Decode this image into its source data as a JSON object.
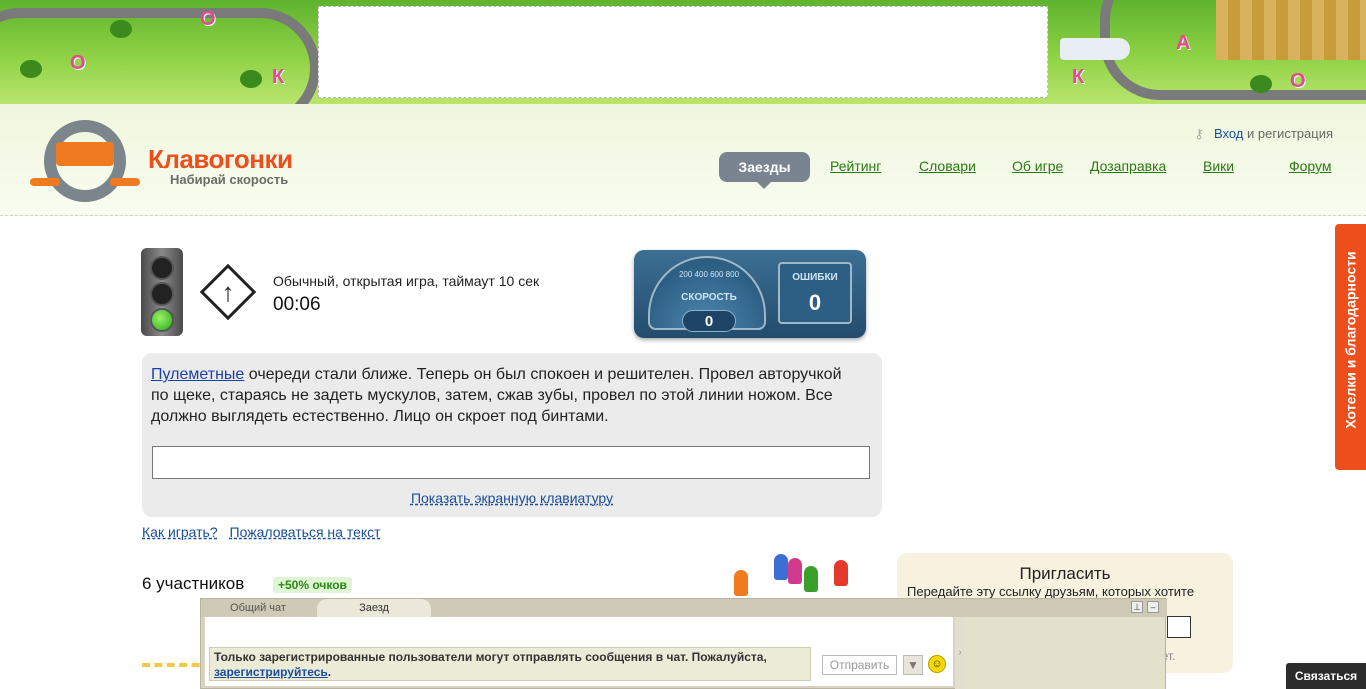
{
  "brand": {
    "name": "Клавогонки",
    "tagline": "Набирай скорость",
    "accent": "#ee4e1c"
  },
  "banner": {
    "letters": [
      "О",
      "К",
      "О",
      "А",
      "К",
      "О"
    ]
  },
  "header": {
    "login_link": "Вход",
    "login_suffix": "и регистрация",
    "nav_active": "Заезды",
    "nav": [
      "Рейтинг",
      "Словари",
      "Об игре",
      "Дозаправка",
      "Вики",
      "Форум"
    ]
  },
  "game": {
    "mode": "Обычный, открытая игра, таймаут 10 сек",
    "timer": "00:06",
    "light": "green",
    "gauge": {
      "label": "СКОРОСТЬ",
      "ticks": "200 400 600 800",
      "speed": "0"
    },
    "errors": {
      "label": "ОШИБКИ",
      "value": "0"
    },
    "text": {
      "first_word": "Пулеметные",
      "rest": "очереди стали ближе. Теперь он был спокоен и решителен. Провел авторучкой по щеке, стараясь не задеть мускулов, затем, сжав зубы, провел по этой линии ножом. Все должно выглядеть естественно. Лицо он скроет под бинтами."
    },
    "input_value": "",
    "keyboard_link": "Показать экранную клавиатуру",
    "help_link": "Как играть?",
    "report_link": "Пожаловаться на текст",
    "participants": "6 участников",
    "bonus": "+50% очков"
  },
  "invite": {
    "title": "Пригласить",
    "text": "Передайте эту ссылку друзьям, которых хотите",
    "tail": "нет."
  },
  "chat": {
    "tabs": [
      "Общий чат",
      "Заезд"
    ],
    "notice": "Только зарегистрированные пользователи могут отправлять сообщения в чат. Пожалуйста,",
    "notice_link": "зарегистрируйтесь",
    "notice_end": ".",
    "send": "Отправить",
    "pin_icon": "pin-icon",
    "min_icon": "minimize-icon"
  },
  "feedback": "Хотелки и благодарности",
  "contact": "Связаться"
}
